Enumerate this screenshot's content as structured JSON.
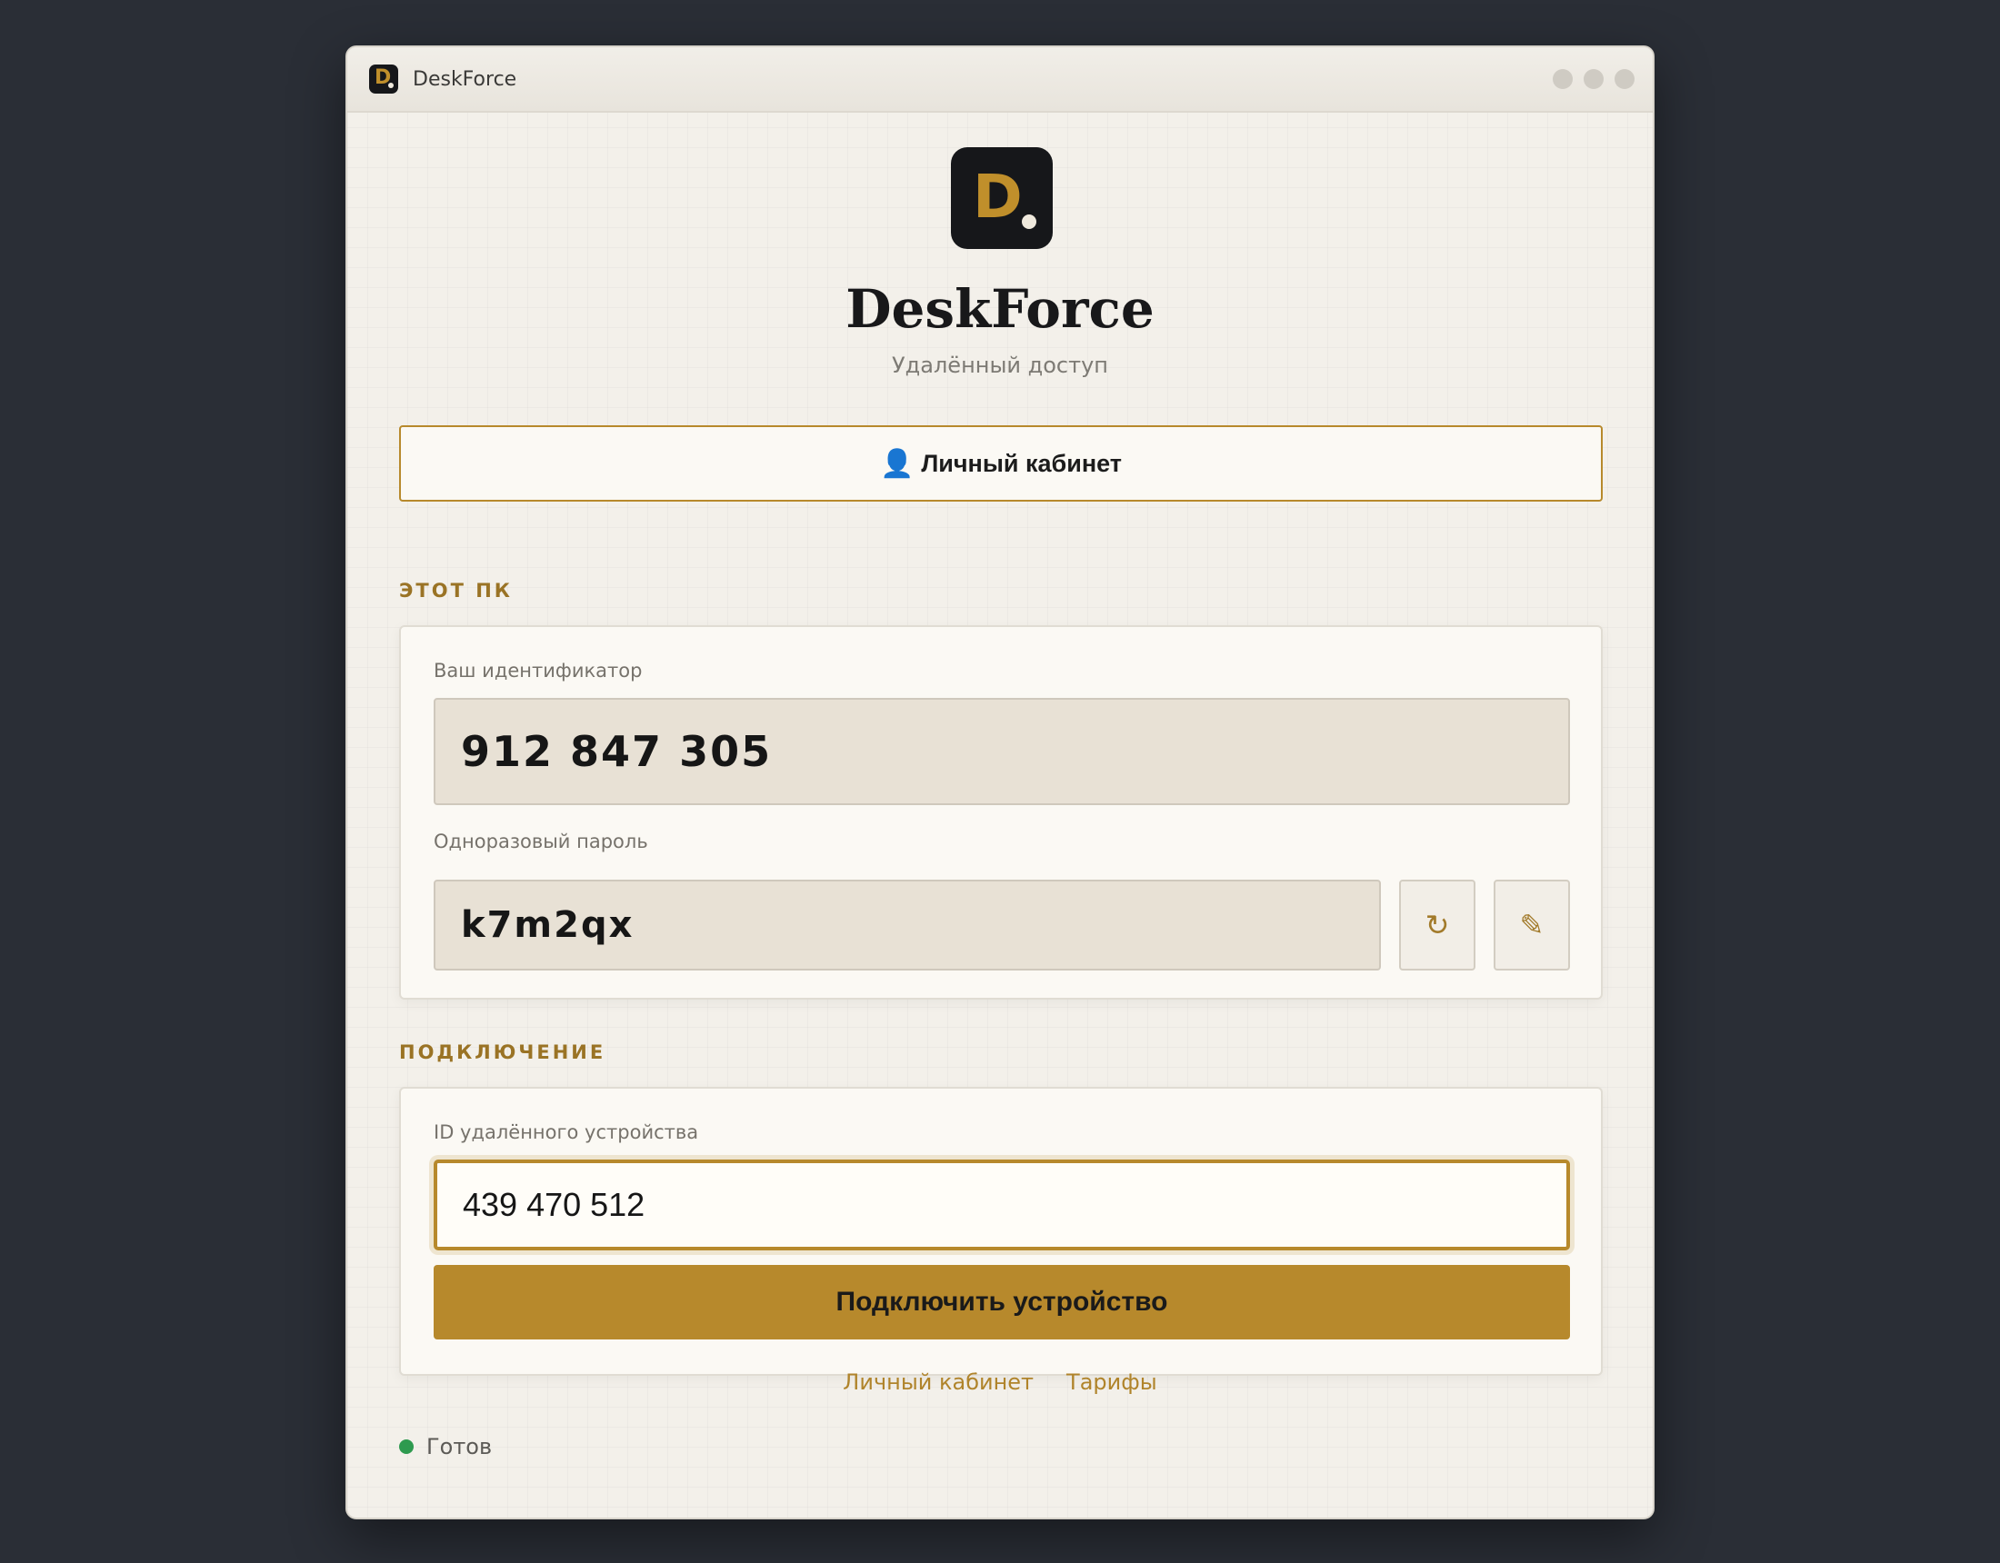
{
  "window": {
    "title": "DeskForce"
  },
  "app": {
    "logo_letter": "D",
    "title": "DeskForce",
    "subtitle": "Удалённый доступ"
  },
  "account_button": {
    "icon": "user-icon",
    "label": "Личный кабинет"
  },
  "this_pc": {
    "section_label": "ЭТОТ ПК",
    "id_label": "Ваш идентификатор",
    "id_value": "912 847 305",
    "password_label": "Одноразовый пароль",
    "password_value": "k7m2qx",
    "refresh_icon": "↻",
    "edit_icon": "✎"
  },
  "connection": {
    "section_label": "ПОДКЛЮЧЕНИЕ",
    "remote_id_label": "ID удалённого устройства",
    "remote_id_value": "439 470 512",
    "connect_label": "Подключить устройство"
  },
  "footer": {
    "links": [
      "Личный кабинет",
      "Тарифы"
    ]
  },
  "status": {
    "text": "Готов",
    "color": "#2e9a4f"
  },
  "colors": {
    "accent": "#b7892c",
    "dark": "#16171a",
    "background": "#2a2e36"
  }
}
